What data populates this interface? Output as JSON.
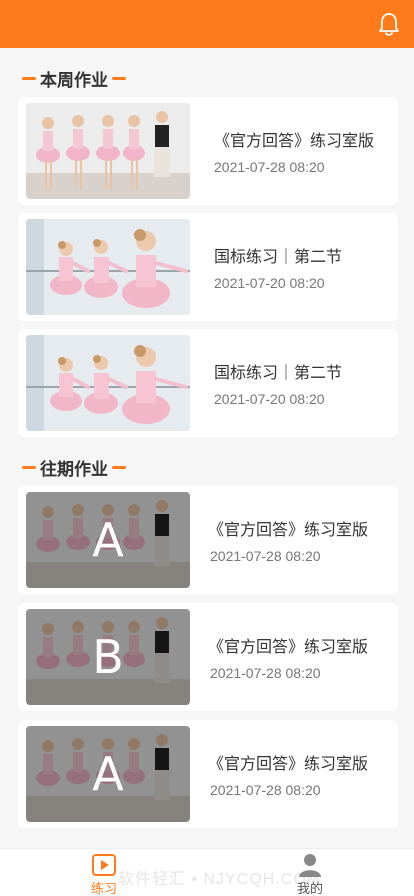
{
  "header": {
    "notification_icon": "bell-icon"
  },
  "sections": {
    "current": {
      "title": "本周作业"
    },
    "past": {
      "title": "往期作业"
    }
  },
  "current_homework": [
    {
      "title": "《官方回答》练习室版",
      "date": "2021-07-28 08:20"
    },
    {
      "title": "国标练习｜第二节",
      "date": "2021-07-20 08:20"
    },
    {
      "title": "国标练习｜第二节",
      "date": "2021-07-20 08:20"
    }
  ],
  "past_homework": [
    {
      "grade": "A",
      "title": "《官方回答》练习室版",
      "date": "2021-07-28 08:20"
    },
    {
      "grade": "B",
      "title": "《官方回答》练习室版",
      "date": "2021-07-28 08:20"
    },
    {
      "grade": "A",
      "title": "《官方回答》练习室版",
      "date": "2021-07-28 08:20"
    }
  ],
  "tabbar": {
    "practice": {
      "label": "练习",
      "icon": "play-video-icon"
    },
    "mine": {
      "label": "我的",
      "icon": "person-icon"
    },
    "watermark": "软件轻汇 • NJYCQH.COM"
  },
  "colors": {
    "accent": "#ff7a1a"
  }
}
